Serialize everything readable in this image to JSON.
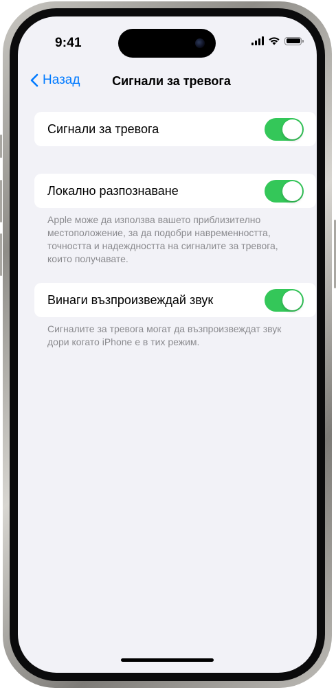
{
  "status_bar": {
    "time": "9:41"
  },
  "nav": {
    "back_label": "Назад",
    "title": "Сигнали за тревога"
  },
  "settings": [
    {
      "label": "Сигнали за тревога",
      "enabled": true,
      "footnote": ""
    },
    {
      "label": "Локално разпознаване",
      "enabled": true,
      "footnote": "Apple може да използва вашето приблизително местоположение, за да подобри навременността, точността и надеждността на сигналите за тревога, които получавате."
    },
    {
      "label": "Винаги възпроизвеждай звук",
      "enabled": true,
      "footnote": "Сигналите за тревога могат да възпроизвеждат звук дори когато iPhone е в тих режим."
    }
  ],
  "colors": {
    "accent": "#007aff",
    "toggle_on": "#34c759",
    "background": "#f2f2f7"
  }
}
